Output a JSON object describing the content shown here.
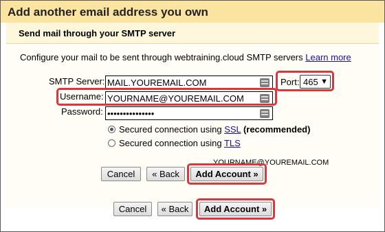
{
  "dialog": {
    "title": "Add another email address you own",
    "subtitle": "Send mail through your SMTP server"
  },
  "form": {
    "description": "Configure your mail to be sent through webtraining.cloud SMTP servers",
    "learn_more": "Learn more",
    "smtp_label": "SMTP Server:",
    "smtp_value": "MAIL.YOUREMAIL.COM",
    "port_label": "Port:",
    "port_value": "465",
    "username_label": "Username:",
    "username_value": "YOURNAME@YOUREMAIL.COM",
    "password_label": "Password:",
    "password_value": "•••••••••••••••",
    "ssl_prefix": "Secured connection using ",
    "ssl_link": "SSL",
    "ssl_suffix": "(recommended)",
    "tls_prefix": "Secured connection using ",
    "tls_link": "TLS",
    "ghost_text": "YOURNAME@YOUREMAIL.COM"
  },
  "buttons": {
    "cancel": "Cancel",
    "back": "« Back",
    "add_account": "Add Account »"
  },
  "colors": {
    "highlight": "#d9363e",
    "titlebar": "#fbe4a0",
    "link": "#1a0dab"
  },
  "icons": [
    "key-icon",
    "chevron-down-icon"
  ]
}
